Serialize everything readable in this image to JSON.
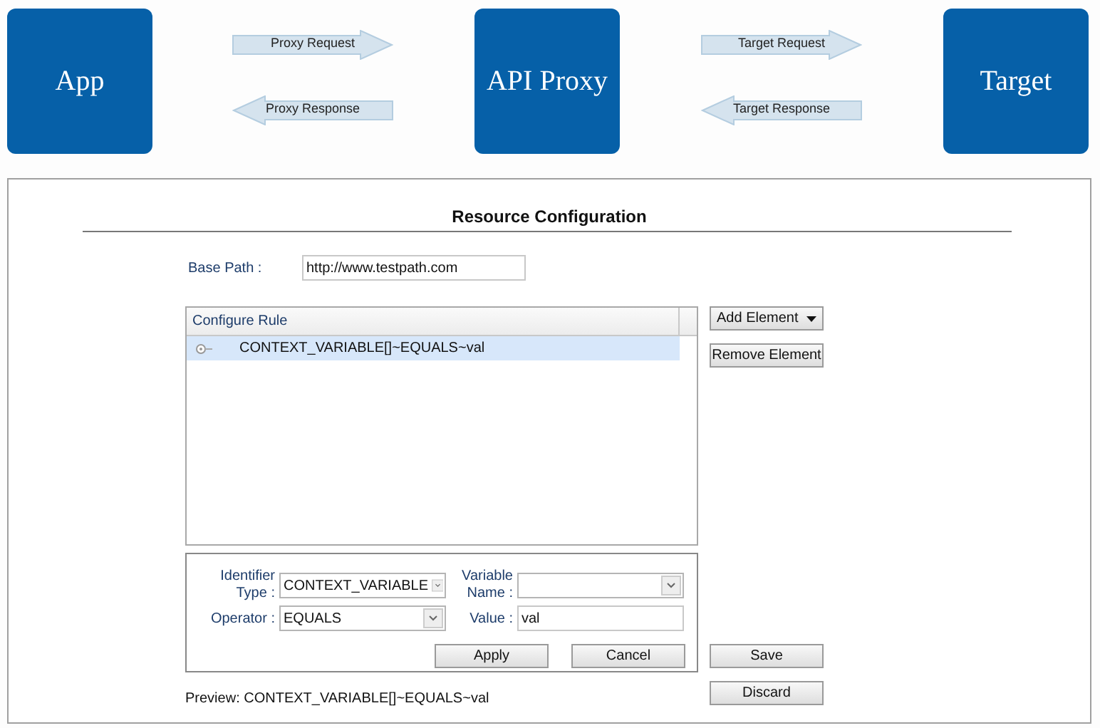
{
  "diagram": {
    "nodes": [
      {
        "label": "App"
      },
      {
        "label": "API Proxy"
      },
      {
        "label": "Target"
      }
    ],
    "connectors": [
      [
        {
          "label": "Proxy Request",
          "kind": "right"
        },
        {
          "label": "Proxy Response",
          "kind": "left"
        }
      ],
      [
        {
          "label": "Target Request",
          "kind": "right"
        },
        {
          "label": "Target Response",
          "kind": "left"
        }
      ]
    ]
  },
  "panel": {
    "title": "Resource Configuration",
    "base_path": {
      "label": "Base Path :",
      "value": "http://www.testpath.com"
    },
    "rule_tree": {
      "header": "Configure Rule",
      "items": [
        {
          "label": "CONTEXT_VARIABLE[]~EQUALS~val",
          "selected": true
        }
      ]
    },
    "side_buttons": [
      {
        "label": "Add Element",
        "kind": "menu"
      },
      {
        "label": "Remove Element",
        "kind": "plain"
      }
    ],
    "form": {
      "identifier_type": {
        "label_lines": [
          "Identifier",
          "Type :"
        ],
        "value": "CONTEXT_VARIABLE"
      },
      "variable_name": {
        "label_lines": [
          "Variable",
          "Name :"
        ]
      },
      "operator": {
        "label": "Operator :",
        "value": "EQUALS"
      },
      "value": {
        "label": "Value :",
        "value": "val"
      },
      "buttons": [
        "Apply",
        "Cancel"
      ]
    },
    "preview": "Preview: CONTEXT_VARIABLE[]~EQUALS~val",
    "actions": [
      "Save",
      "Discard"
    ]
  }
}
